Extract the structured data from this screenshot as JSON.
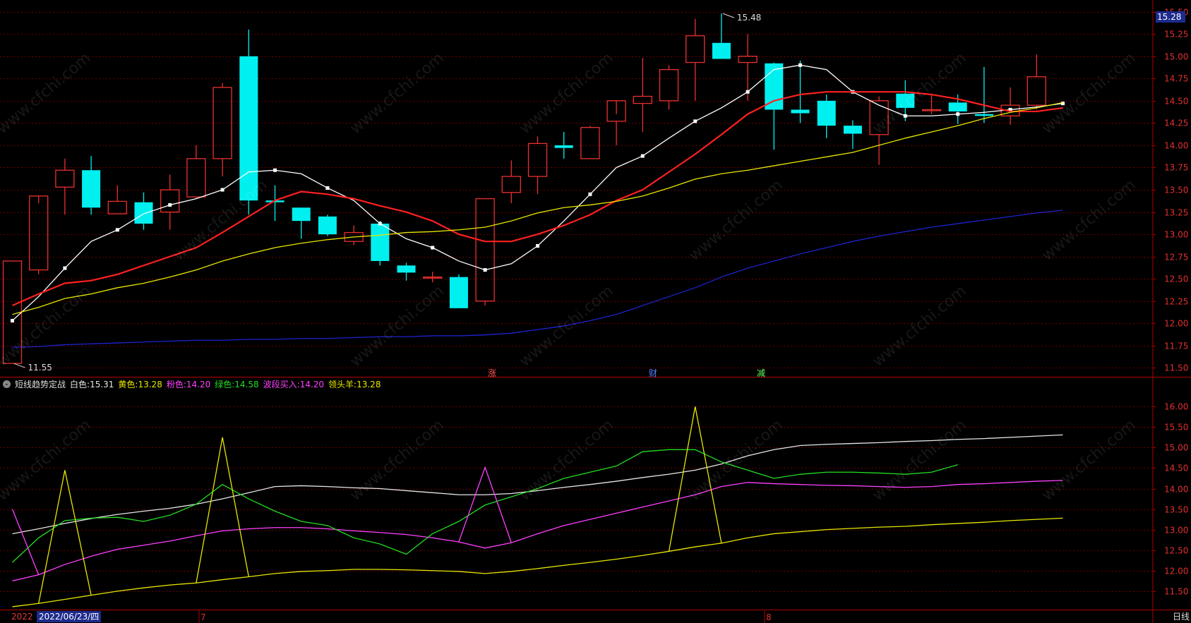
{
  "legend": {
    "name": "短线趋势定战",
    "items": [
      {
        "label": "白色:",
        "value": "15.31",
        "color": "#e6e6e6"
      },
      {
        "label": "黄色:",
        "value": "13.28",
        "color": "#e7e700"
      },
      {
        "label": "粉色:",
        "value": "14.20",
        "color": "#ff40ff"
      },
      {
        "label": "绿色:",
        "value": "14.58",
        "color": "#22dd22"
      },
      {
        "label": "波段买入:",
        "value": "14.20",
        "color": "#ff40ff"
      },
      {
        "label": "领头羊:",
        "value": "13.28",
        "color": "#e7e700"
      }
    ]
  },
  "current_price_tag": "15.28",
  "date_box": "2022/06/23/四",
  "year_label": "2022",
  "period_label": "日线",
  "month_labels": [
    "7",
    "8"
  ],
  "event_markers": [
    {
      "text": "涨",
      "color": "#ff5050",
      "bar": 18
    },
    {
      "text": "财",
      "color": "#5080ff",
      "bar": 24
    },
    {
      "text": "减",
      "color": "#60ff60",
      "bar": 28
    }
  ],
  "watermark": "www.cfchi.com",
  "colors": {
    "up": "#e8312f",
    "down": "#00f0f0",
    "grid": "#6a0000",
    "axis": "#b00000",
    "bg": "#000000"
  },
  "chart_data": [
    {
      "type": "candlestick",
      "ylim": [
        11.4,
        15.6
      ],
      "y_ticks": [
        "15.50",
        "15.25",
        "15.00",
        "14.75",
        "14.50",
        "14.25",
        "14.00",
        "13.75",
        "13.50",
        "13.25",
        "13.00",
        "12.75",
        "12.50",
        "12.25",
        "12.00",
        "11.75",
        "11.50"
      ],
      "annotations": [
        {
          "text": "15.48",
          "bar": 27,
          "value": 15.48
        },
        {
          "text": "11.55",
          "bar": 0,
          "value": 11.55
        }
      ],
      "candles": [
        {
          "o": 11.55,
          "h": 12.7,
          "l": 11.55,
          "c": 12.7
        },
        {
          "o": 12.6,
          "h": 13.35,
          "l": 12.55,
          "c": 13.43
        },
        {
          "o": 13.53,
          "h": 13.85,
          "l": 13.22,
          "c": 13.72
        },
        {
          "o": 13.72,
          "h": 13.88,
          "l": 13.22,
          "c": 13.3
        },
        {
          "o": 13.23,
          "h": 13.55,
          "l": 13.23,
          "c": 13.37
        },
        {
          "o": 13.36,
          "h": 13.47,
          "l": 13.05,
          "c": 13.12
        },
        {
          "o": 13.25,
          "h": 13.67,
          "l": 13.05,
          "c": 13.5
        },
        {
          "o": 13.42,
          "h": 14.0,
          "l": 13.4,
          "c": 13.85
        },
        {
          "o": 13.85,
          "h": 14.7,
          "l": 13.65,
          "c": 14.65
        },
        {
          "o": 15.0,
          "h": 15.3,
          "l": 13.22,
          "c": 13.38
        },
        {
          "o": 13.38,
          "h": 13.55,
          "l": 13.15,
          "c": 13.36
        },
        {
          "o": 13.3,
          "h": 13.3,
          "l": 12.95,
          "c": 13.15
        },
        {
          "o": 13.2,
          "h": 13.22,
          "l": 12.98,
          "c": 13.0
        },
        {
          "o": 12.92,
          "h": 13.1,
          "l": 12.88,
          "c": 13.02
        },
        {
          "o": 13.12,
          "h": 13.15,
          "l": 12.65,
          "c": 12.7
        },
        {
          "o": 12.65,
          "h": 12.68,
          "l": 12.48,
          "c": 12.57
        },
        {
          "o": 12.52,
          "h": 12.58,
          "l": 12.46,
          "c": 12.52
        },
        {
          "o": 12.52,
          "h": 12.55,
          "l": 12.18,
          "c": 12.17
        },
        {
          "o": 12.25,
          "h": 13.4,
          "l": 12.2,
          "c": 13.4
        },
        {
          "o": 13.47,
          "h": 13.83,
          "l": 13.35,
          "c": 13.65
        },
        {
          "o": 13.65,
          "h": 14.1,
          "l": 13.45,
          "c": 14.02
        },
        {
          "o": 14.0,
          "h": 14.15,
          "l": 13.85,
          "c": 13.97
        },
        {
          "o": 13.85,
          "h": 14.22,
          "l": 13.85,
          "c": 14.2
        },
        {
          "o": 14.27,
          "h": 14.35,
          "l": 14.0,
          "c": 14.5
        },
        {
          "o": 14.47,
          "h": 14.98,
          "l": 14.15,
          "c": 14.55
        },
        {
          "o": 14.5,
          "h": 14.9,
          "l": 14.4,
          "c": 14.85
        },
        {
          "o": 14.93,
          "h": 15.42,
          "l": 14.5,
          "c": 15.23
        },
        {
          "o": 15.15,
          "h": 15.48,
          "l": 15.0,
          "c": 14.97
        },
        {
          "o": 14.93,
          "h": 15.25,
          "l": 14.5,
          "c": 15.0
        },
        {
          "o": 14.92,
          "h": 14.93,
          "l": 13.95,
          "c": 14.4
        },
        {
          "o": 14.4,
          "h": 14.95,
          "l": 14.25,
          "c": 14.36
        },
        {
          "o": 14.5,
          "h": 14.57,
          "l": 14.08,
          "c": 14.22
        },
        {
          "o": 14.22,
          "h": 14.28,
          "l": 13.96,
          "c": 14.13
        },
        {
          "o": 14.12,
          "h": 14.55,
          "l": 13.78,
          "c": 14.5
        },
        {
          "o": 14.58,
          "h": 14.73,
          "l": 14.27,
          "c": 14.42
        },
        {
          "o": 14.4,
          "h": 14.58,
          "l": 14.35,
          "c": 14.4
        },
        {
          "o": 14.48,
          "h": 14.57,
          "l": 14.24,
          "c": 14.38
        },
        {
          "o": 14.35,
          "h": 14.88,
          "l": 14.25,
          "c": 14.33
        },
        {
          "o": 14.33,
          "h": 14.65,
          "l": 14.23,
          "c": 14.45
        },
        {
          "o": 14.45,
          "h": 15.02,
          "l": 14.4,
          "c": 14.77
        }
      ],
      "series": [
        {
          "color": "#ffffff",
          "markers": true,
          "values": [
            12.03,
            12.3,
            12.62,
            12.92,
            13.05,
            13.23,
            13.33,
            13.4,
            13.5,
            13.7,
            13.72,
            13.68,
            13.52,
            13.38,
            13.12,
            12.95,
            12.85,
            12.7,
            12.6,
            12.67,
            12.87,
            13.15,
            13.45,
            13.75,
            13.88,
            14.08,
            14.27,
            14.42,
            14.6,
            14.85,
            14.9,
            14.85,
            14.6,
            14.45,
            14.33,
            14.33,
            14.35,
            14.37,
            14.4,
            14.43,
            14.47
          ]
        },
        {
          "color": "#ff2020",
          "values": [
            12.2,
            12.33,
            12.45,
            12.48,
            12.55,
            12.65,
            12.75,
            12.85,
            13.02,
            13.2,
            13.38,
            13.48,
            13.45,
            13.4,
            13.32,
            13.25,
            13.15,
            13.0,
            12.92,
            12.92,
            13.0,
            13.1,
            13.22,
            13.38,
            13.5,
            13.7,
            13.9,
            14.12,
            14.35,
            14.5,
            14.57,
            14.6,
            14.6,
            14.6,
            14.6,
            14.57,
            14.52,
            14.45,
            14.38,
            14.38,
            14.42
          ]
        },
        {
          "color": "#e7e700",
          "values": [
            12.1,
            12.18,
            12.28,
            12.33,
            12.4,
            12.45,
            12.52,
            12.6,
            12.7,
            12.78,
            12.85,
            12.9,
            12.94,
            12.97,
            12.99,
            13.02,
            13.03,
            13.05,
            13.08,
            13.15,
            13.24,
            13.3,
            13.33,
            13.37,
            13.43,
            13.52,
            13.62,
            13.68,
            13.72,
            13.77,
            13.82,
            13.87,
            13.92,
            14.0,
            14.08,
            14.15,
            14.22,
            14.3,
            14.37,
            14.42,
            14.48
          ]
        },
        {
          "color": "#1e22cc",
          "values": [
            11.73,
            11.74,
            11.76,
            11.77,
            11.78,
            11.79,
            11.8,
            11.81,
            11.81,
            11.82,
            11.82,
            11.83,
            11.83,
            11.84,
            11.85,
            11.85,
            11.86,
            11.86,
            11.87,
            11.89,
            11.93,
            11.97,
            12.03,
            12.1,
            12.2,
            12.3,
            12.4,
            12.52,
            12.62,
            12.7,
            12.78,
            12.85,
            12.92,
            12.98,
            13.03,
            13.08,
            13.12,
            13.16,
            13.2,
            13.24,
            13.27
          ]
        }
      ]
    },
    {
      "type": "line",
      "ylim": [
        11.05,
        16.4
      ],
      "y_ticks": [
        "16.00",
        "15.50",
        "15.00",
        "14.50",
        "14.00",
        "13.50",
        "13.00",
        "12.50",
        "12.00",
        "11.50"
      ],
      "series": [
        {
          "name": "白色",
          "color": "#e6e6e6",
          "values": [
            12.9,
            13.02,
            13.15,
            13.27,
            13.37,
            13.45,
            13.52,
            13.62,
            13.75,
            13.9,
            14.05,
            14.07,
            14.05,
            14.02,
            14.0,
            13.95,
            13.9,
            13.85,
            13.85,
            13.88,
            13.95,
            14.03,
            14.1,
            14.18,
            14.27,
            14.35,
            14.45,
            14.6,
            14.8,
            14.95,
            15.05,
            15.08,
            15.1,
            15.12,
            15.15,
            15.17,
            15.2,
            15.22,
            15.25,
            15.28,
            15.31
          ]
        },
        {
          "name": "黄色",
          "color": "#e7e700",
          "values": [
            11.12,
            11.2,
            11.3,
            11.4,
            11.5,
            11.58,
            11.65,
            11.7,
            11.78,
            11.85,
            11.93,
            11.98,
            12.0,
            12.03,
            12.03,
            12.02,
            12.0,
            11.98,
            11.93,
            11.98,
            12.05,
            12.13,
            12.2,
            12.28,
            12.37,
            12.47,
            12.58,
            12.67,
            12.8,
            12.9,
            12.95,
            13.0,
            13.03,
            13.06,
            13.08,
            13.12,
            13.15,
            13.18,
            13.22,
            13.25,
            13.28
          ]
        },
        {
          "name": "粉色",
          "color": "#ff40ff",
          "values": [
            11.75,
            11.9,
            12.15,
            12.35,
            12.52,
            12.62,
            12.72,
            12.85,
            12.97,
            13.02,
            13.05,
            13.05,
            13.02,
            12.97,
            12.93,
            12.88,
            12.8,
            12.7,
            12.55,
            12.68,
            12.9,
            13.1,
            13.25,
            13.4,
            13.55,
            13.7,
            13.85,
            14.05,
            14.15,
            14.12,
            14.1,
            14.08,
            14.07,
            14.05,
            14.03,
            14.05,
            14.1,
            14.12,
            14.15,
            14.18,
            14.2
          ]
        },
        {
          "name": "绿色",
          "color": "#22dd22",
          "values": [
            12.2,
            12.8,
            13.22,
            13.28,
            13.3,
            13.2,
            13.35,
            13.62,
            14.1,
            13.75,
            13.45,
            13.2,
            13.1,
            12.8,
            12.65,
            12.4,
            12.9,
            13.2,
            13.6,
            13.8,
            14.0,
            14.25,
            14.4,
            14.55,
            14.9,
            14.95,
            14.95,
            14.65,
            14.45,
            14.25,
            14.35,
            14.4,
            14.4,
            14.38,
            14.35,
            14.4,
            14.58
          ]
        },
        {
          "name": "波段买入",
          "color": "#ff40ff",
          "peaks": [
            {
              "bar": 0,
              "value": 13.5
            },
            {
              "bar": 18,
              "value": 14.52
            }
          ]
        },
        {
          "name": "领头羊",
          "color": "#e7e700",
          "peaks": [
            {
              "bar": 2,
              "value": 14.45
            },
            {
              "bar": 8,
              "value": 15.25
            },
            {
              "bar": 26,
              "value": 16.0
            }
          ]
        }
      ]
    }
  ]
}
